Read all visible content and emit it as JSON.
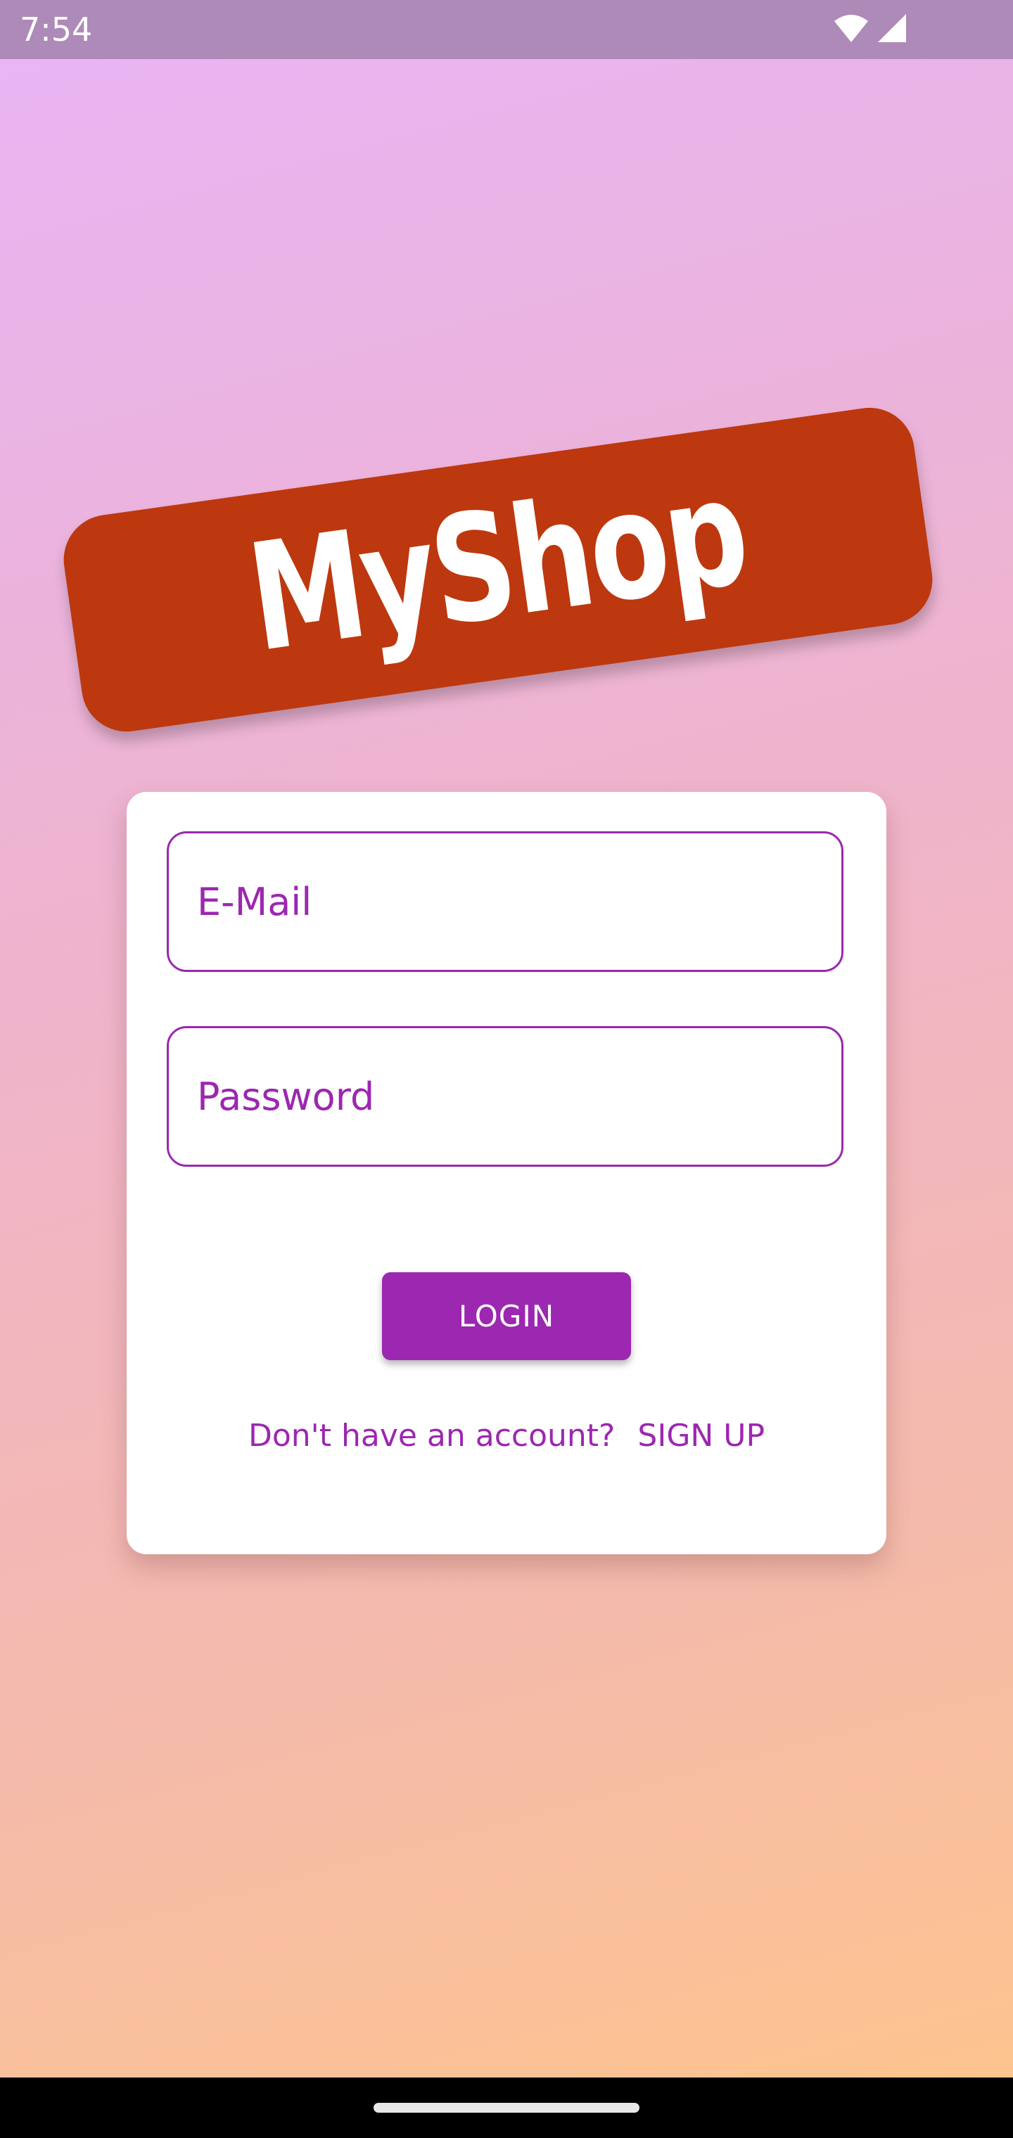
{
  "status_bar": {
    "time": "7:54",
    "icons": [
      "wifi-icon",
      "cell-signal-icon"
    ]
  },
  "app": {
    "title": "MyShop",
    "accent_color": "#9c27b0",
    "banner_color": "#bd380e"
  },
  "login_form": {
    "email_placeholder": "E-Mail",
    "email_value": "",
    "password_placeholder": "Password",
    "password_value": "",
    "login_label": "LOGIN",
    "signup_prompt": "Don't have an account?",
    "signup_label": "SIGN UP"
  }
}
